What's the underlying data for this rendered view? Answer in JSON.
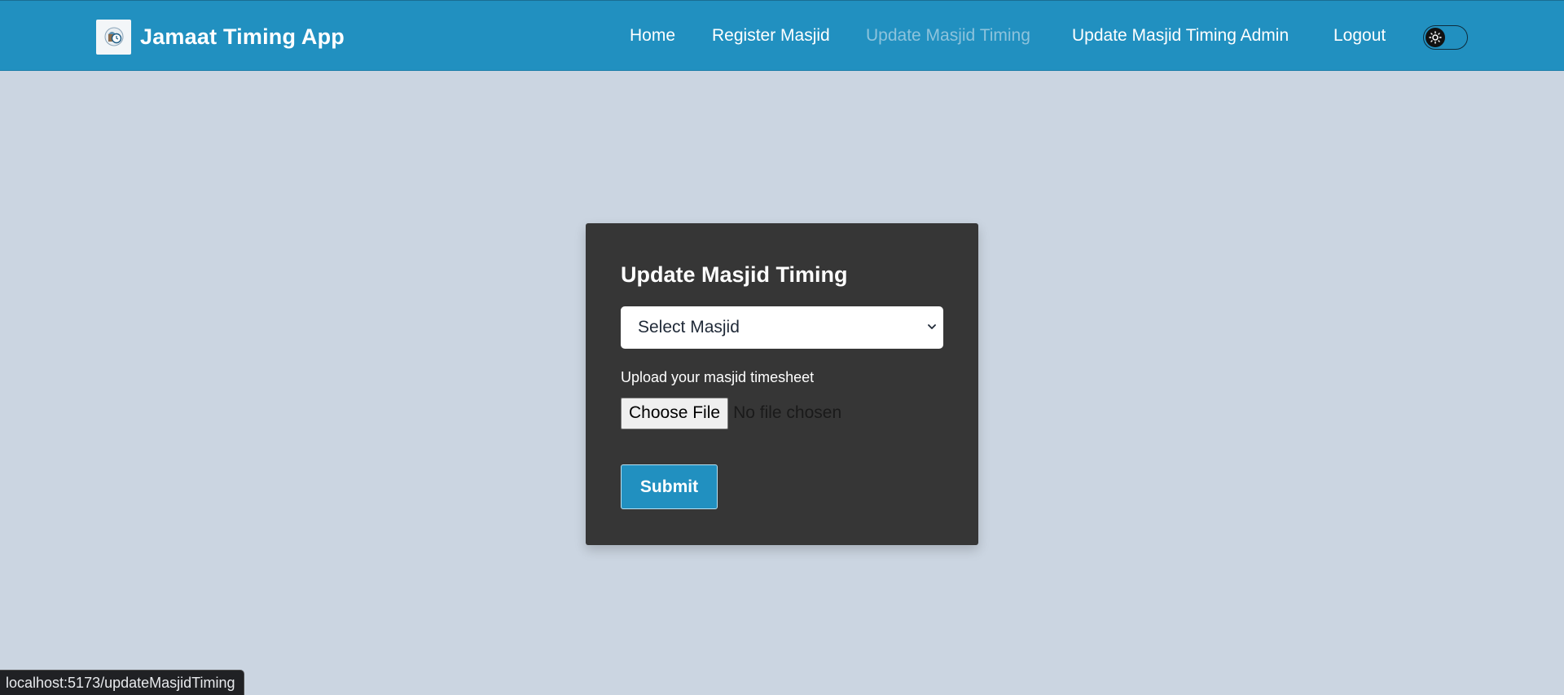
{
  "header": {
    "brand_title": "Jamaat Timing App",
    "logo_icon": "mosque-clock-icon",
    "nav": [
      {
        "label": "Home",
        "active": false
      },
      {
        "label": "Register Masjid",
        "active": false
      },
      {
        "label": "Update Masjid Timing",
        "active": true
      },
      {
        "label": "Update Masjid Timing Admin",
        "active": false
      },
      {
        "label": "Logout",
        "active": false
      }
    ],
    "theme_toggle_icon": "sun-icon"
  },
  "form": {
    "title": "Update Masjid Timing",
    "select_value": "Select Masjid",
    "upload_label": "Upload your masjid timesheet",
    "file_button_label": "Choose File",
    "file_status": "No file chosen",
    "submit_label": "Submit"
  },
  "statusbar": {
    "url": "localhost:5173/updateMasjidTiming"
  },
  "colors": {
    "navbar": "#2190c0",
    "background": "#cbd5e1",
    "card": "#363636",
    "active_link": "#8dc3dc"
  }
}
